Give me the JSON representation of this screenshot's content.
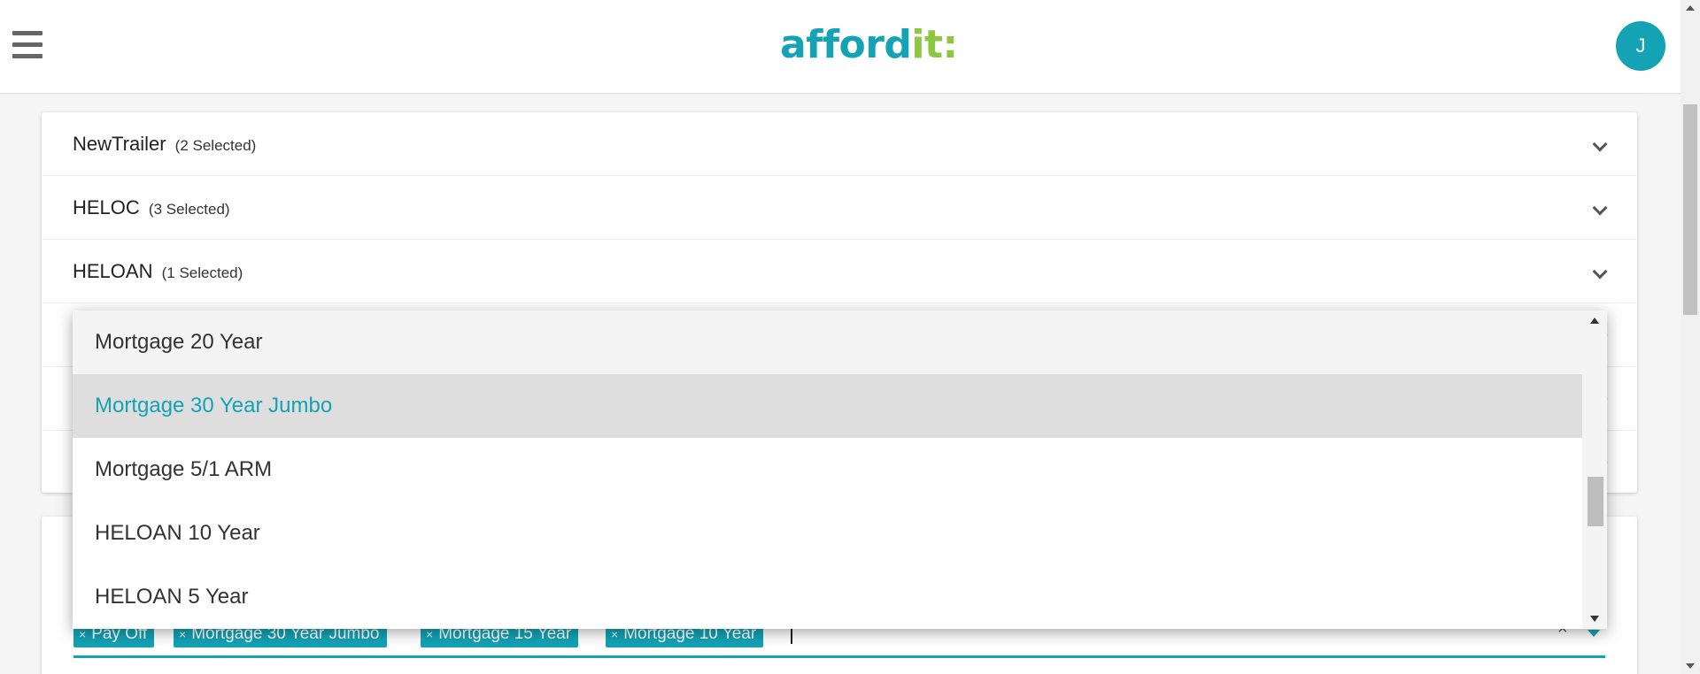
{
  "header": {
    "logo_part1": "afford",
    "logo_part2": "it:",
    "avatar_initial": "J",
    "menu_icon": "hamburger-icon"
  },
  "accordion": [
    {
      "title": "NewTrailer",
      "count": "(2 Selected)"
    },
    {
      "title": "HELOC",
      "count": "(3 Selected)"
    },
    {
      "title": "HELOAN",
      "count": "(1 Selected)"
    }
  ],
  "dropdown": {
    "options": [
      {
        "label": "Mortgage 20 Year"
      },
      {
        "label": "Mortgage 30 Year Jumbo"
      },
      {
        "label": "Mortgage 5/1 ARM"
      },
      {
        "label": "HELOAN 10 Year"
      },
      {
        "label": "HELOAN 5 Year"
      }
    ],
    "highlighted": "Mortgage 30 Year Jumbo"
  },
  "tags": {
    "remove_glyph": "×",
    "items": [
      "Pay Off",
      "Mortgage 30 Year Jumbo",
      "Mortgage 15 Year",
      "Mortgage 10 Year"
    ],
    "clear_glyph": "×"
  },
  "colors": {
    "brand_teal": "#13a3b5",
    "brand_green": "#8dc63f"
  }
}
